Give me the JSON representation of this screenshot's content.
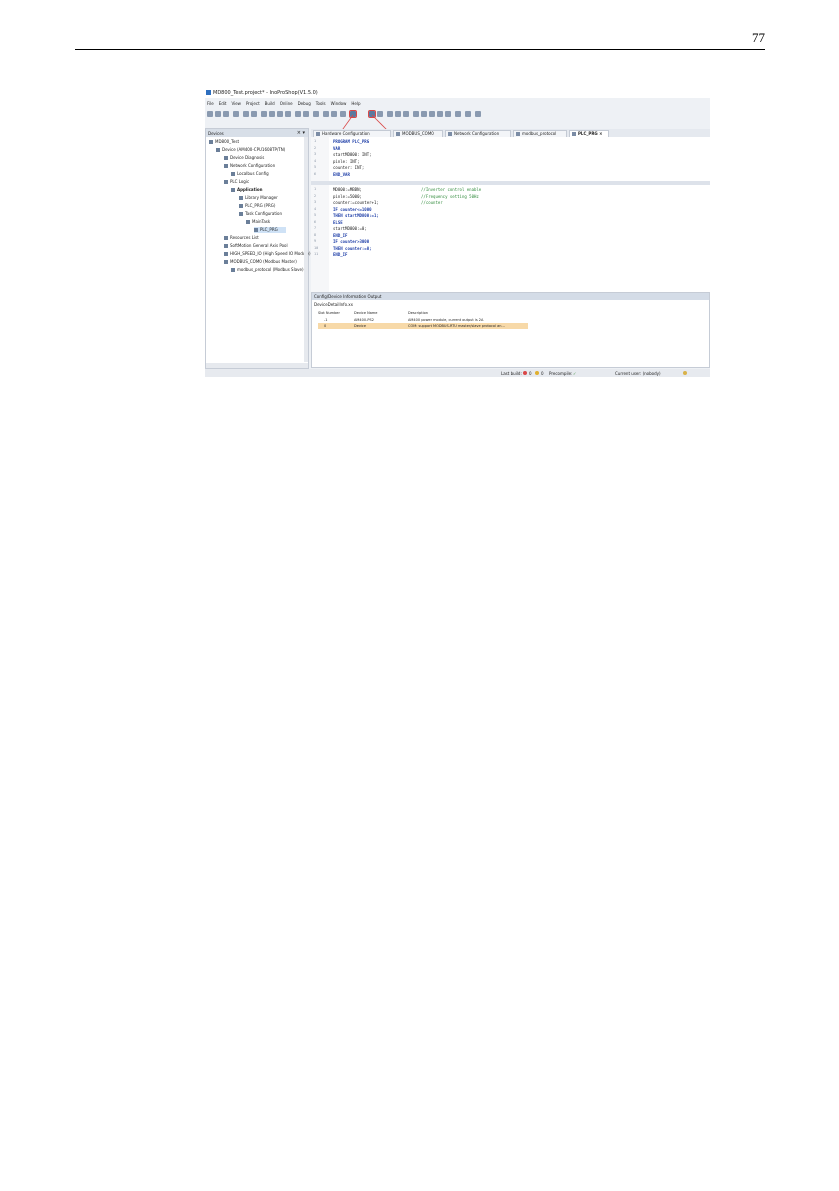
{
  "page": {
    "number": "77"
  },
  "window": {
    "title": "MD800_Test.project* - InoProShop(V1.5.0)"
  },
  "menu": [
    "File",
    "Edit",
    "View",
    "Project",
    "Build",
    "Online",
    "Debug",
    "Tools",
    "Window",
    "Help"
  ],
  "devices_panel": {
    "title": "Devices",
    "tree": [
      "MD800_Test",
      "Device (AM400-CPU1608TP/TN)",
      "Device Diagnosis",
      "Network Configuration",
      "Localbus Config",
      "PLC Logic",
      "Application",
      "Library Manager",
      "PLC_PRG (PRG)",
      "Task Configuration",
      "MainTask",
      "PLC_PRG",
      "Resources List",
      "SoftMotion General Axis Pool",
      "HIGH_SPEED_IO (High Speed IO Module)",
      "MODBUS_COM0 (Modbus Master)",
      "modbus_protocol (Modbus Slave)"
    ]
  },
  "tabs": [
    {
      "label": "Hardware Configuration"
    },
    {
      "label": "MODBUS_COM0"
    },
    {
      "label": "Network Configuration"
    },
    {
      "label": "modbus_protocol"
    },
    {
      "label": "PLC_PRG",
      "active": true
    }
  ],
  "editor": {
    "declarations": [
      {
        "n": "1",
        "text": "PROGRAM PLC_PRG"
      },
      {
        "n": "2",
        "text": "VAR"
      },
      {
        "n": "3",
        "text": "    startMD800: INT;"
      },
      {
        "n": "4",
        "text": "    pinle: INT;"
      },
      {
        "n": "5",
        "text": "    counter: INT;"
      },
      {
        "n": "6",
        "text": "END_VAR"
      }
    ],
    "body": [
      {
        "n": "1",
        "code": "MD800:=MBBN;",
        "comment": "//Inverter control enable"
      },
      {
        "n": "2",
        "code": "pinle:=5000;",
        "comment": "//Frequency setting 50Hz"
      },
      {
        "n": "3",
        "code": "counter:=counter+1;",
        "comment": "//counter"
      },
      {
        "n": "4",
        "code": "IF counter<=1000",
        "comment": ""
      },
      {
        "n": "5",
        "code": "    THEN startMD800:=1;",
        "comment": ""
      },
      {
        "n": "6",
        "code": "    ELSE",
        "comment": ""
      },
      {
        "n": "7",
        "code": "        startMD800:=0;",
        "comment": ""
      },
      {
        "n": "8",
        "code": "    END_IF",
        "comment": ""
      },
      {
        "n": "9",
        "code": "IF counter>3000",
        "comment": ""
      },
      {
        "n": "10",
        "code": "    THEN counter:=0;",
        "comment": ""
      },
      {
        "n": "11",
        "code": "END_IF",
        "comment": ""
      }
    ]
  },
  "info_panel": {
    "title": "Config/Device Information Output",
    "subtitle": "DeviceDetailInfo.xx",
    "columns": [
      "Slot Number",
      "Device Name",
      "Description"
    ],
    "rows": [
      {
        "slot": "-1",
        "name": "AM400-PS2",
        "desc": "AM400 power module, current output is 2A"
      },
      {
        "slot": "0",
        "name": "Device",
        "desc": "COM: support MODBUS-RTU master/slave protocol an..."
      }
    ]
  },
  "status": {
    "last_build": "Last build:",
    "errors": "0",
    "warnings": "0",
    "precompile": "Precompile:",
    "current_user": "Current user: (nobody)"
  }
}
